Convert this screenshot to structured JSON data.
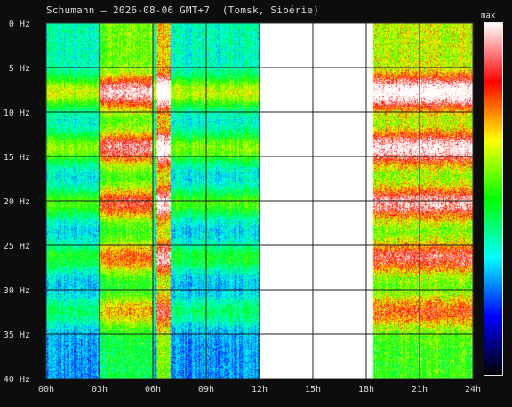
{
  "chart_data": {
    "type": "heatmap",
    "title": "Schumann — 2026-08-06 GMT+7  (Tomsk, Sibérie)",
    "x_ticks": [
      "00h",
      "03h",
      "06h",
      "09h",
      "12h",
      "15h",
      "18h",
      "21h",
      "24h"
    ],
    "y_ticks": [
      "0 Hz",
      "5 Hz",
      "10 Hz",
      "15 Hz",
      "20 Hz",
      "25 Hz",
      "30 Hz",
      "35 Hz",
      "40 Hz"
    ],
    "x_range_hours": [
      0,
      24
    ],
    "y_range_hz": [
      0,
      40
    ],
    "grid": true,
    "colorbar": {
      "label": "max",
      "colors": [
        "#000000",
        "#0000ff",
        "#00ffff",
        "#00ff00",
        "#ffff00",
        "#ff0000",
        "#ffffff"
      ]
    },
    "bands_hz": [
      7.8,
      14.1,
      20.3,
      26.4,
      32.5
    ],
    "features": [
      {
        "from_h": 12.0,
        "to_h": 18.4,
        "level": 1.0
      },
      {
        "from_h": 6.2,
        "to_h": 7.0,
        "level": 0.9
      },
      {
        "from_h": 18.0,
        "to_h": 24.0,
        "level": 0.75
      },
      {
        "from_h": 3.0,
        "to_h": 6.0,
        "level": 0.55
      }
    ]
  }
}
